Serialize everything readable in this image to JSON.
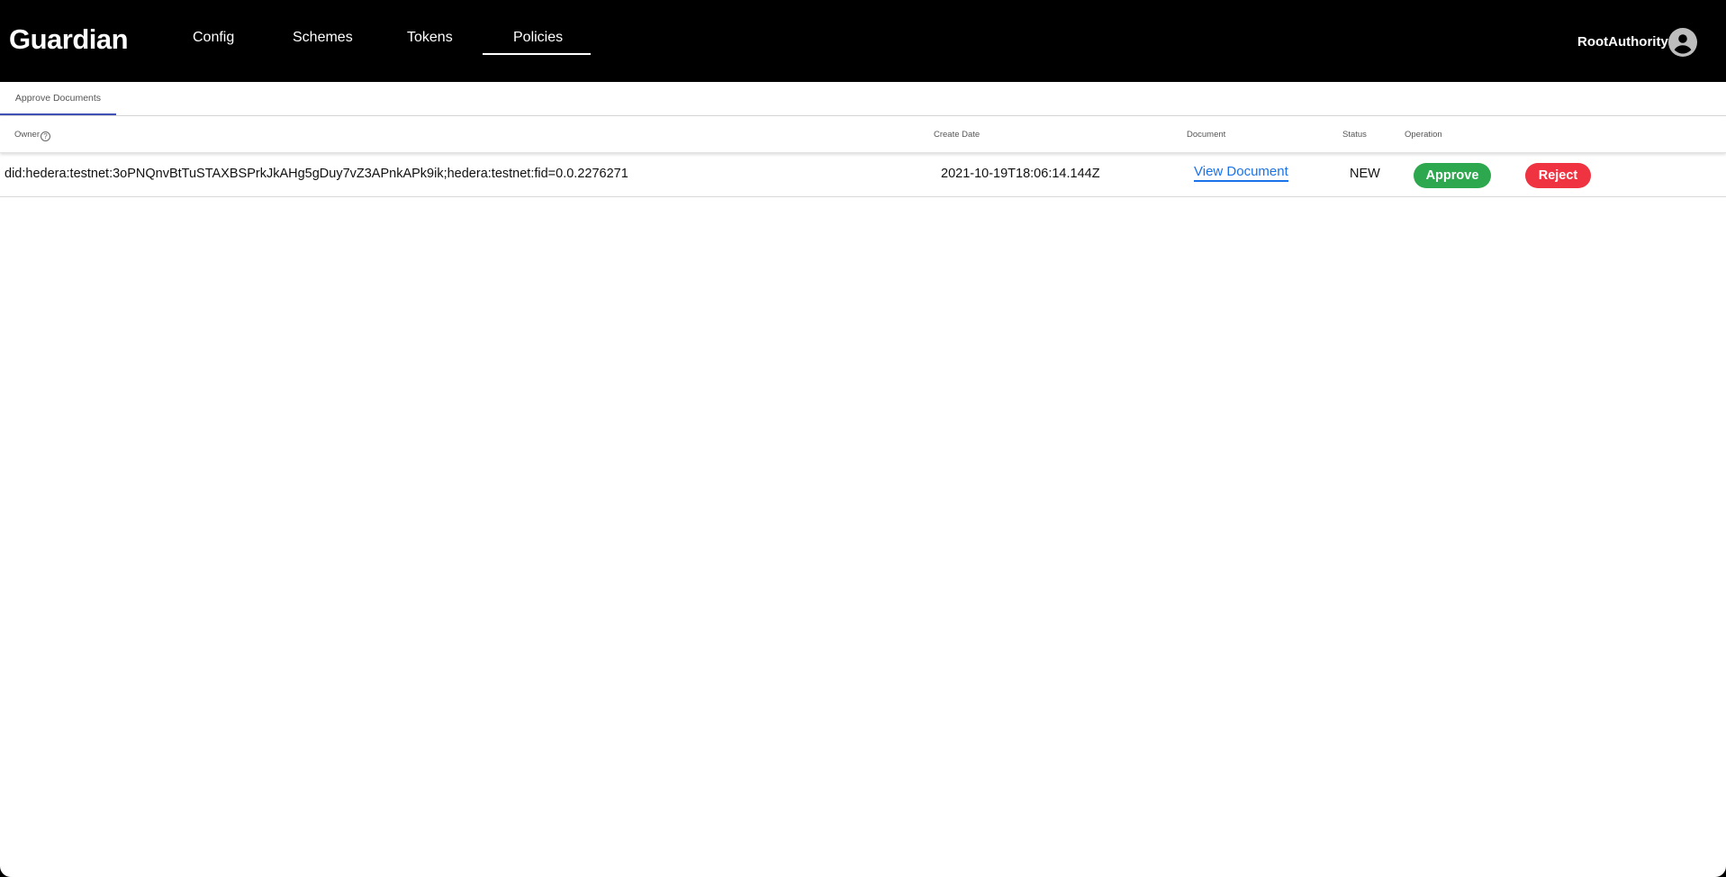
{
  "header": {
    "logo": "Guardian",
    "nav": [
      {
        "label": "Config"
      },
      {
        "label": "Schemes"
      },
      {
        "label": "Tokens"
      },
      {
        "label": "Policies",
        "active": true
      }
    ],
    "user": "RootAuthority",
    "user_icon": "account-circle-icon"
  },
  "tabs": [
    {
      "label": "Approve Documents",
      "active": true
    }
  ],
  "table": {
    "columns": [
      "Owner",
      "Create Date",
      "Document",
      "Status",
      "Operation"
    ],
    "owner_help_icon": "?",
    "rows": [
      {
        "owner": "did:hedera:testnet:3oPNQnvBtTuSTAXBSPrkJkAHg5gDuy7vZ3APnkAPk9ik;hedera:testnet:fid=0.0.2276271",
        "create_date": "2021-10-19T18:06:14.144Z",
        "document_link": "View Document",
        "status": "NEW",
        "approve_label": "Approve",
        "reject_label": "Reject"
      }
    ]
  },
  "colors": {
    "header_bg": "#000000",
    "tab_indicator": "#3f51b5",
    "link": "#1a73e8",
    "approve": "#2ea84e",
    "reject": "#ef3340"
  }
}
